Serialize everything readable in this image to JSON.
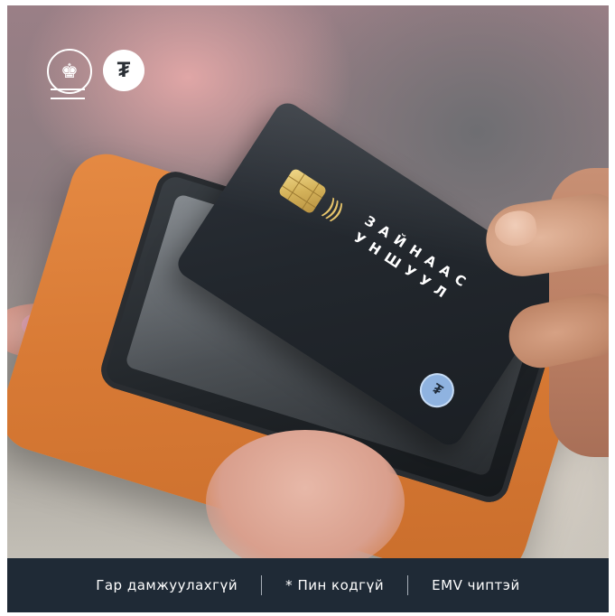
{
  "card": {
    "text_line1": "ЗАЙНААС",
    "text_line2": "УНШУУЛ"
  },
  "banner": {
    "features": [
      "Гар дамжуулахгүй",
      "* Пин кодгүй",
      "EMV чиптэй"
    ]
  },
  "logos": {
    "emblem_icon": "state-emblem-icon",
    "brand_icon": "bank-brand-icon"
  },
  "colors": {
    "terminal_orange": "#d87a35",
    "card_dark": "#22272d",
    "chip_gold": "#d4b25a",
    "banner_navy": "#1f2a36"
  }
}
